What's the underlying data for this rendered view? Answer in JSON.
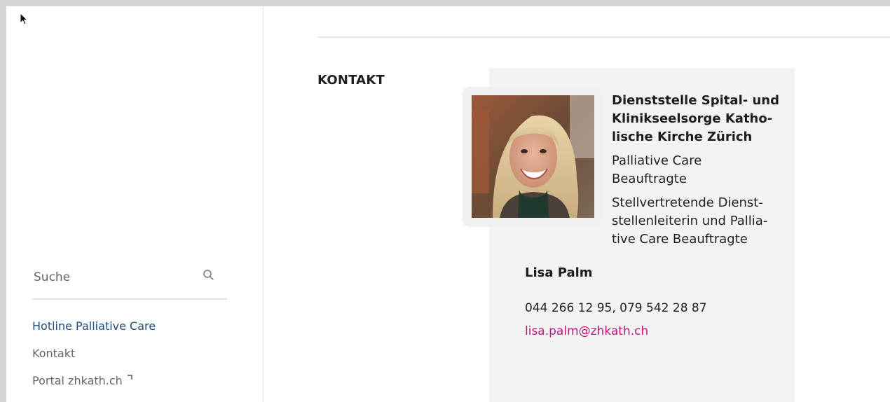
{
  "sidebar": {
    "search": {
      "placeholder": "Suche",
      "icon": "search-icon"
    },
    "nav": [
      {
        "label": "Hotline Palliative Care",
        "active": true
      },
      {
        "label": "Kontakt",
        "active": false
      },
      {
        "label": "Portal zhkath.ch",
        "external": true
      }
    ]
  },
  "main": {
    "section_title": "KONTAKT",
    "contact": {
      "org_lines": [
        "Dienststelle Spital- und",
        "Klinikseelsorge Katho-",
        "lische Kirche Zürich"
      ],
      "role1_lines": [
        "Palliative Care",
        "Beauftragte"
      ],
      "role2_lines": [
        "Stellvertretende Dienst-",
        "stellenleiterin und Pallia-",
        "tive Care Beauftragte"
      ],
      "name": "Lisa Palm",
      "phone": "044 266 12 95, 079 542 28 87",
      "email": "lisa.palm@zhkath.ch"
    }
  },
  "colors": {
    "active_nav": "#1f4e79",
    "link": "#c4147a",
    "card_bg": "#f3f3f3"
  }
}
